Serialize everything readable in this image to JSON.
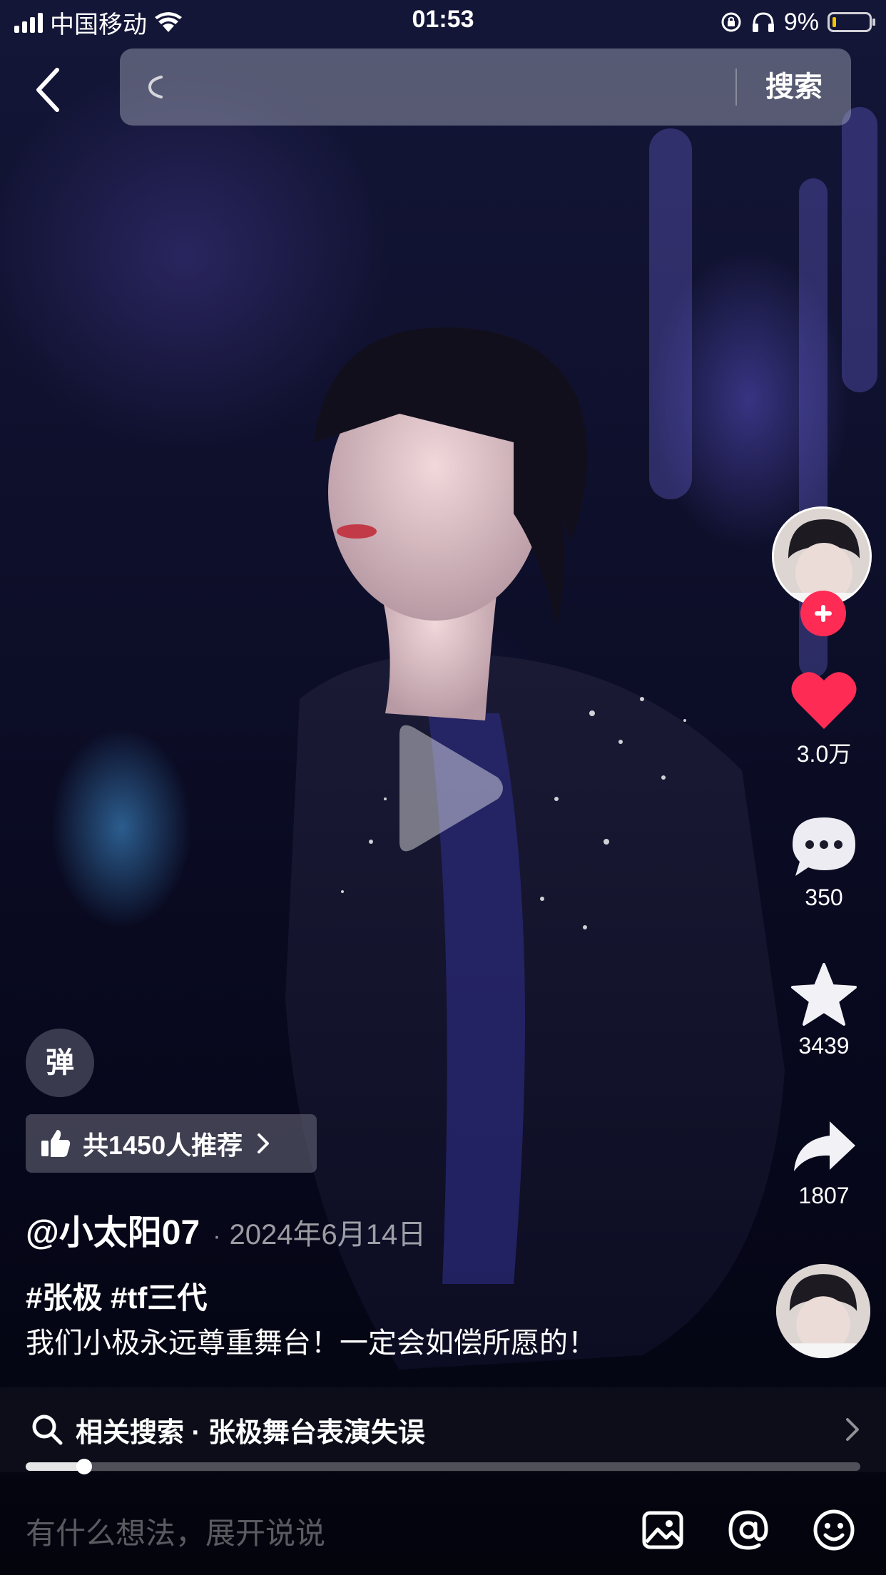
{
  "status_bar": {
    "carrier": "中国移动",
    "time": "01:53",
    "battery_percent": "9%",
    "battery_level": 0.09,
    "icons": [
      "signal-icon",
      "wifi-icon",
      "rotation-lock-icon",
      "headphones-icon",
      "battery-icon"
    ]
  },
  "search": {
    "button_label": "搜索",
    "placeholder": ""
  },
  "side_rail": {
    "likes": "3.0万",
    "comments": "350",
    "favorites": "3439",
    "shares": "1807"
  },
  "overlays": {
    "danmu_label": "弹",
    "recommend_text": "共1450人推荐"
  },
  "post": {
    "author": "@小太阳07",
    "separator": "·",
    "date": "2024年6月14日",
    "hashtags": "#张极 #tf三代",
    "caption": "我们小极永远尊重舞台！一定会如偿所愿的！"
  },
  "related_search": {
    "text": "相关搜索 · 张极舞台表演失误"
  },
  "playback": {
    "progress": 0.07
  },
  "comment_bar": {
    "placeholder": "有什么想法，展开说说"
  },
  "colors": {
    "like_red": "#fe2c55",
    "battery_low": "#f5c400"
  }
}
